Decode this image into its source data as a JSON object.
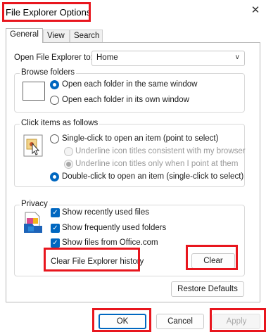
{
  "window": {
    "title": "File Explorer Options",
    "close_glyph": "✕"
  },
  "tabs": [
    {
      "label": "General",
      "active": true
    },
    {
      "label": "View",
      "active": false
    },
    {
      "label": "Search",
      "active": false
    }
  ],
  "open_explorer": {
    "label": "Open File Explorer to:",
    "value": "Home"
  },
  "browse_folders": {
    "legend": "Browse folders",
    "options": [
      {
        "label": "Open each folder in the same window",
        "selected": true
      },
      {
        "label": "Open each folder in its own window",
        "selected": false
      }
    ]
  },
  "click_items": {
    "legend": "Click items as follows",
    "single": {
      "label": "Single-click to open an item (point to select)",
      "selected": false
    },
    "sub_options": [
      {
        "label": "Underline icon titles consistent with my browser",
        "selected": false
      },
      {
        "label": "Underline icon titles only when I point at them",
        "selected": true
      }
    ],
    "double": {
      "label": "Double-click to open an item (single-click to select)",
      "selected": true
    }
  },
  "privacy": {
    "legend": "Privacy",
    "checks": [
      {
        "label": "Show recently used files",
        "checked": true
      },
      {
        "label": "Show frequently used folders",
        "checked": true
      },
      {
        "label": "Show files from Office.com",
        "checked": true
      }
    ],
    "clear_history_label": "Clear File Explorer history",
    "clear_button": "Clear"
  },
  "restore_defaults": "Restore Defaults",
  "footer": {
    "ok": "OK",
    "cancel": "Cancel",
    "apply": "Apply"
  },
  "colors": {
    "accent": "#0067c0",
    "highlight": "#e8161e"
  }
}
